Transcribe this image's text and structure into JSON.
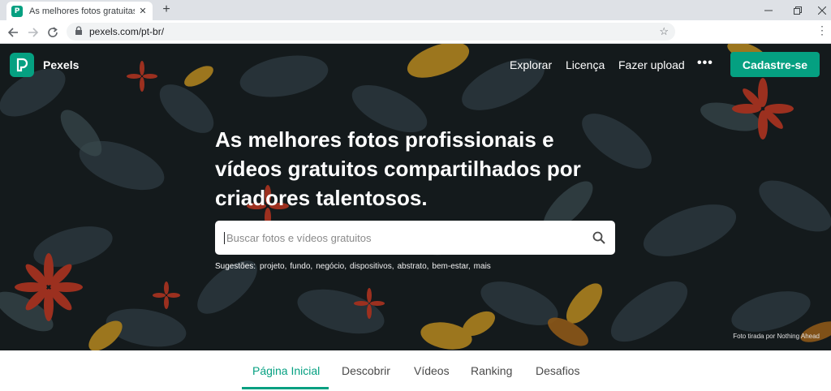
{
  "browser": {
    "tab_title": "As melhores fotos gratuitas · Pexels",
    "url": "pexels.com/pt-br/"
  },
  "header": {
    "brand": "Pexels",
    "nav": [
      "Explorar",
      "Licença",
      "Fazer upload"
    ],
    "more": "•••",
    "signup": "Cadastre-se"
  },
  "hero": {
    "headline": "As melhores fotos profissionais e vídeos gratuitos compartilhados por criadores talentosos.",
    "search_placeholder": "Buscar fotos e vídeos gratuitos",
    "suggestions_label": "Sugestões:",
    "suggestions": [
      "projeto,",
      "fundo,",
      "negócio,",
      "dispositivos,",
      "abstrato,",
      "bem-estar,",
      "mais"
    ],
    "photo_credit": "Foto tirada por Nothing Ahead"
  },
  "tabs": {
    "items": [
      "Página Inicial",
      "Descobrir",
      "Vídeos",
      "Ranking",
      "Desafios"
    ],
    "active": "Página Inicial"
  },
  "colors": {
    "accent": "#05a081",
    "hero_dark": "#1b2326",
    "flower_red": "#d9432c",
    "leaf_yellow": "#d9a42a"
  }
}
